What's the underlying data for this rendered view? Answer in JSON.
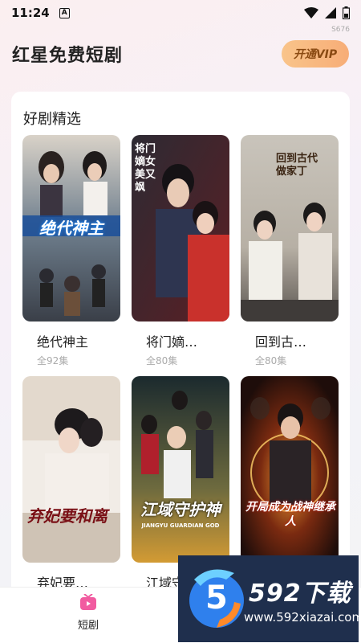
{
  "status_bar": {
    "time": "11:24",
    "notification_letter": "A"
  },
  "watermark": "S676",
  "header": {
    "title": "红星免费短剧",
    "vip_label": "开通VIP"
  },
  "section": {
    "title": "好剧精选"
  },
  "dramas": [
    {
      "title": "绝代神主",
      "episodes": "全92集",
      "poster_text": "绝代神主",
      "poster_icon": "poster-image"
    },
    {
      "title": "将门嫡…",
      "episodes": "全80集",
      "poster_text": "将门嫡女美又飒",
      "poster_icon": "poster-image"
    },
    {
      "title": "回到古…",
      "episodes": "全80集",
      "poster_text": "回到古代做家丁",
      "poster_icon": "poster-image"
    },
    {
      "title": "弃妃要…",
      "episodes": "",
      "poster_text": "弃妃要和离",
      "poster_icon": "poster-image"
    },
    {
      "title": "江域守…",
      "episodes": "",
      "poster_text": "江域守护神",
      "poster_subtext": "JIANGYU GUARDIAN GOD",
      "poster_icon": "poster-image"
    },
    {
      "title": "",
      "episodes": "",
      "poster_text": "开局成为战神继承人",
      "poster_icon": "poster-image"
    }
  ],
  "bottom_nav": {
    "items": [
      {
        "label": "短剧",
        "icon": "tv-icon"
      }
    ]
  },
  "site_logo": {
    "mark": "5",
    "brand": "592下载",
    "url": "www.592xiazai.com"
  },
  "colors": {
    "accent_vip": "#f7ad77",
    "nav_icon": "#f15ba0",
    "logo_bg": "#1f2f4d"
  }
}
